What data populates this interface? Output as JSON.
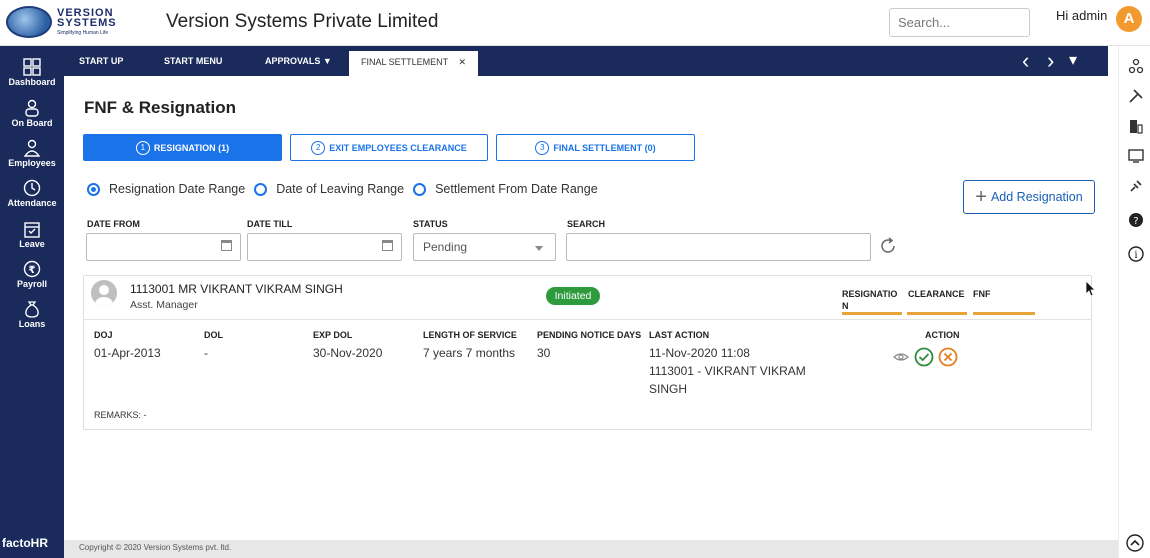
{
  "header": {
    "logo_line1": "VERSION",
    "logo_line2": "SYSTEMS",
    "logo_tagline": "Simplifying Human Life",
    "app_title": "Version Systems Private Limited",
    "search_placeholder": "Search...",
    "greeting": "Hi admin",
    "avatar_letter": "A"
  },
  "sidebar": {
    "items": [
      {
        "label": "Dashboard",
        "icon": "dashboard-icon"
      },
      {
        "label": "On Board",
        "icon": "onboard-icon"
      },
      {
        "label": "Employees",
        "icon": "employees-icon"
      },
      {
        "label": "Attendance",
        "icon": "clock-icon"
      },
      {
        "label": "Leave",
        "icon": "calendar-icon"
      },
      {
        "label": "Payroll",
        "icon": "rupee-icon"
      },
      {
        "label": "Loans",
        "icon": "money-bag-icon"
      }
    ],
    "footer_brand": "factoHR"
  },
  "tabs": [
    {
      "label": "START UP"
    },
    {
      "label": "START MENU"
    },
    {
      "label": "APPROVALS ▼"
    },
    {
      "label": "FINAL SETTLEMENT"
    }
  ],
  "tab_close": "✕",
  "nav": {
    "prev": "‹",
    "next": "›",
    "more": "▾"
  },
  "page": {
    "title": "FNF & Resignation",
    "steps": [
      {
        "num": "1",
        "label": "RESIGNATION (1)"
      },
      {
        "num": "2",
        "label": "EXIT EMPLOYEES CLEARANCE"
      },
      {
        "num": "3",
        "label": "FINAL SETTLEMENT (0)"
      }
    ],
    "radios": [
      {
        "label": "Resignation Date Range",
        "checked": true
      },
      {
        "label": "Date of Leaving Range",
        "checked": false
      },
      {
        "label": "Settlement From Date Range",
        "checked": false
      }
    ],
    "add_button": "Add Resignation",
    "filters": {
      "date_from_label": "DATE FROM",
      "date_till_label": "DATE TILL",
      "status_label": "STATUS",
      "status_value": "Pending",
      "search_label": "SEARCH"
    }
  },
  "employee": {
    "name": "1113001 MR VIKRANT VIKRAM SINGH",
    "role": "Asst. Manager",
    "status": "Initiated",
    "columns": [
      "RESIGNATIO N",
      "CLEARANCE",
      "FNF"
    ],
    "details": {
      "doj_label": "DOJ",
      "doj": "01-Apr-2013",
      "dol_label": "DOL",
      "dol": "-",
      "exp_dol_label": "EXP DOL",
      "exp_dol": "30-Nov-2020",
      "los_label": "LENGTH OF SERVICE",
      "los": "7 years 7 months",
      "pnd_label": "PENDING NOTICE DAYS",
      "pnd": "30",
      "last_action_label": "LAST ACTION",
      "last_action_line1": "11-Nov-2020 11:08",
      "last_action_line2": "1113001 - VIKRANT VIKRAM",
      "last_action_line3": "SINGH",
      "action_label": "ACTION"
    },
    "remarks": "REMARKS: -"
  },
  "footer": {
    "copyright": "Copyright © 2020 Version Systems pvt. ltd."
  },
  "colors": {
    "navy": "#1a2a5b",
    "primary": "#1a73e8",
    "success": "#2e9a3e",
    "orange": "#f29a2e",
    "bar": "#e8a33a"
  }
}
